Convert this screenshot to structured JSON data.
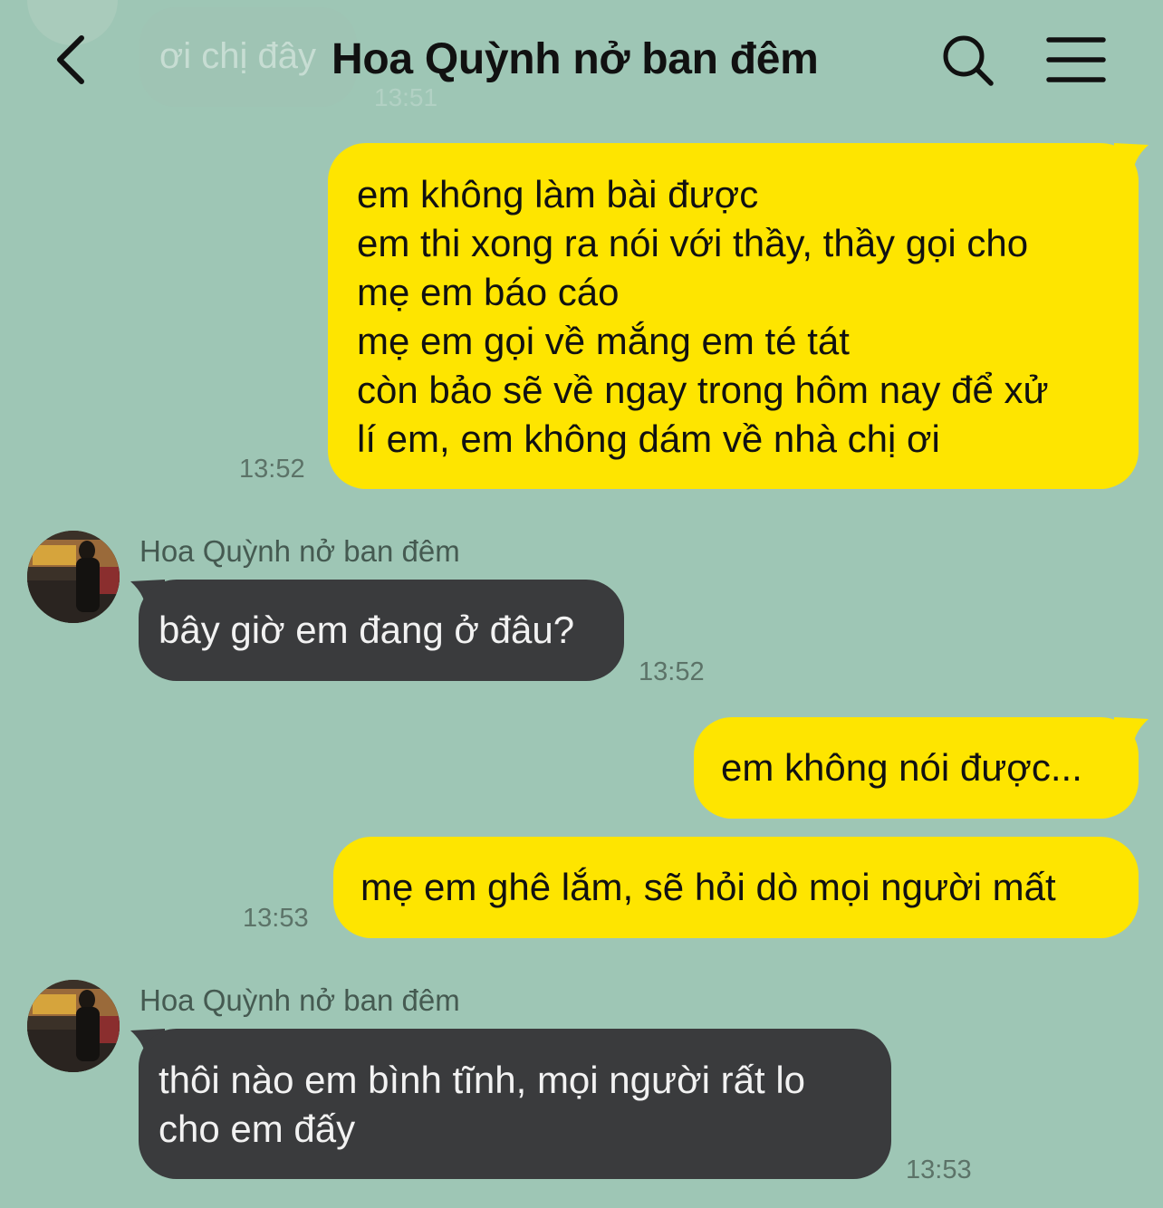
{
  "header": {
    "title": "Hoa Quỳnh nở ban đêm"
  },
  "faded_previous": {
    "text": "ơi chị đây",
    "time": "13:51"
  },
  "messages": [
    {
      "direction": "outgoing",
      "lines": [
        "em không làm bài được",
        "em thi xong ra nói với thầy, thầy gọi cho",
        "mẹ em báo cáo",
        "mẹ em gọi về mắng em té tát",
        "còn bảo sẽ về ngay trong hôm nay để xử",
        "lí em, em không dám về nhà chị ơi"
      ],
      "time": "13:52"
    },
    {
      "direction": "incoming",
      "sender": "Hoa Quỳnh nở ban đêm",
      "lines": [
        "bây giờ em đang ở đâu?"
      ],
      "time": "13:52"
    },
    {
      "direction": "outgoing",
      "lines": [
        "em không nói được..."
      ]
    },
    {
      "direction": "outgoing",
      "lines": [
        "mẹ em ghê lắm, sẽ hỏi dò mọi người mất"
      ],
      "time": "13:53"
    },
    {
      "direction": "incoming",
      "sender": "Hoa Quỳnh nở ban đêm",
      "lines": [
        "thôi nào em bình tĩnh, mọi người rất lo",
        "cho em đấy"
      ],
      "time": "13:53"
    }
  ],
  "colors": {
    "background": "#9ec6b5",
    "outgoing_bubble": "#fee500",
    "incoming_bubble": "#3a3b3d"
  },
  "icons": {
    "back": "chevron-left-icon",
    "search": "search-icon",
    "menu": "hamburger-menu-icon",
    "avatar": "avatar"
  }
}
